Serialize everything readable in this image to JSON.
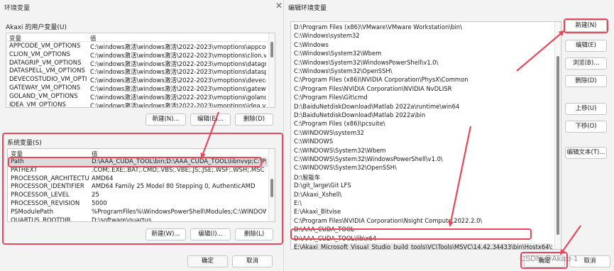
{
  "env_dialog": {
    "title": "环境变量",
    "close_glyph": "✕",
    "user_section": {
      "label": "Akaxi 的用户变量(U)",
      "columns": [
        "变量",
        "值"
      ],
      "rows": [
        {
          "name": "APPCODE_VM_OPTIONS",
          "value": "C:\\windows激活\\windows激活\\2022-2023\\vmoptions\\appcode.vm..."
        },
        {
          "name": "CLION_VM_OPTIONS",
          "value": "C:\\windows激活\\windows激活\\2022-2023\\vmoptions\\clion.vmopti..."
        },
        {
          "name": "DATAGRIP_VM_OPTIONS",
          "value": "C:\\windows激活\\windows激活\\2022-2023\\vmoptions\\datagrip.vm..."
        },
        {
          "name": "DATASPELL_VM_OPTIONS",
          "value": "C:\\windows激活\\windows激活\\2022-2023\\vmoptions\\dataspell.vm..."
        },
        {
          "name": "DEVECOSTUDIO_VM_OPTIO...",
          "value": "C:\\windows激活\\windows激活\\2022-2023\\vmoptions\\devecostudio..."
        },
        {
          "name": "GATEWAY_VM_OPTIONS",
          "value": "C:\\windows激活\\windows激活\\2022-2023\\vmoptions\\gateway.vm..."
        },
        {
          "name": "GOLAND_VM_OPTIONS",
          "value": "C:\\windows激活\\windows激活\\2022-2023\\vmoptions\\goland.vmo..."
        },
        {
          "name": "IDEA_VM_OPTIONS",
          "value": "C:\\windows激活\\windows激活\\2022-2023\\vmoptions\\idea.vmopti..."
        }
      ],
      "buttons": {
        "new": "新建(N)...",
        "edit": "编辑(E)...",
        "delete": "删除(D)"
      }
    },
    "system_section": {
      "label": "系统变量(S)",
      "columns": [
        "变量",
        "值"
      ],
      "rows": [
        {
          "name": "Path",
          "value": "D:\\AAA_CUDA_TOOL\\bin;D:\\AAA_CUDA_TOOL\\libnvvp;C:\\Progra..."
        },
        {
          "name": "PATHEXT",
          "value": ".COM;.EXE;.BAT;.CMD;.VBS;.VBE;.JS;.JSE;.WSF;.WSH;.MSC"
        },
        {
          "name": "PROCESSOR_ARCHITECTURE",
          "value": "AMD64"
        },
        {
          "name": "PROCESSOR_IDENTIFIER",
          "value": "AMD64 Family 25 Model 80 Stepping 0, AuthenticAMD"
        },
        {
          "name": "PROCESSOR_LEVEL",
          "value": "25"
        },
        {
          "name": "PROCESSOR_REVISION",
          "value": "5000"
        },
        {
          "name": "PSModulePath",
          "value": "%ProgramFiles%\\WindowsPowerShell\\Modules;C:\\WINDOWS\\syst..."
        },
        {
          "name": "QUARTUS_ROOTDIR",
          "value": "D:\\software\\quartus"
        }
      ],
      "buttons": {
        "new": "新建(W)...",
        "edit": "编辑(I)...",
        "delete": "删除(L)"
      }
    },
    "footer": {
      "ok": "确定",
      "cancel": "取消"
    }
  },
  "edit_dialog": {
    "title": "编辑环境变量",
    "entries": [
      "D:\\Program Files (x86)\\VMware\\VMware Workstation\\bin\\",
      "C:\\Windows\\system32",
      "C:\\Windows",
      "C:\\Windows\\System32\\Wbem",
      "C:\\Windows\\System32\\WindowsPowerShell\\v1.0\\",
      "C:\\Windows\\System32\\OpenSSH\\",
      "C:\\Program Files (x86)\\NVIDIA Corporation\\PhysX\\Common",
      "C:\\Program Files\\NVIDIA Corporation\\NVIDIA NvDLISR",
      "C:\\Program Files\\Git\\cmd",
      "D:\\BaiduNetdiskDownload\\Matlab 2022a\\runtime\\win64",
      "D:\\BaiduNetdiskDownload\\Matlab 2022a\\bin",
      "C:\\Program Files (x86)\\pcsuite\\",
      "C:\\WINDOWS\\system32",
      "C:\\WINDOWS",
      "C:\\WINDOWS\\System32\\Wbem",
      "C:\\WINDOWS\\System32\\WindowsPowerShell\\v1.0\\",
      "C:\\WINDOWS\\System32\\OpenSSH\\",
      "D:\\智能车",
      "D:\\git_large\\Git LFS",
      "D:\\Akaxi_Xshell\\",
      "E:\\",
      "E:\\Akaxi_Bitvise",
      "C:\\Program Files\\NVIDIA Corporation\\Nsight Compute 2022.2.0\\",
      "D:\\AAA_CUDA_TOOL",
      "D:\\AAA_CUDA_TOOL\\lib\\x64",
      "E:\\Akaxi_Microsoft_Visual_Studio_build_tools\\VC\\Tools\\MSVC\\14.42.34433\\bin\\Hostx64\\x64"
    ],
    "buttons": {
      "new": "新建(N)",
      "edit": "编辑(E)",
      "browse": "浏览(B)...",
      "delete": "删除(D)",
      "move_up": "上移(U)",
      "move_down": "下移(O)",
      "edit_text": "编辑文本(T)..."
    },
    "footer": {
      "ok": "确定",
      "cancel": "取消"
    }
  },
  "watermark": "CSDN @Akaxi-1",
  "colors": {
    "highlight": "#e5485a",
    "selection": "#dcdcdc",
    "window_bg": "#f3f3f3"
  }
}
